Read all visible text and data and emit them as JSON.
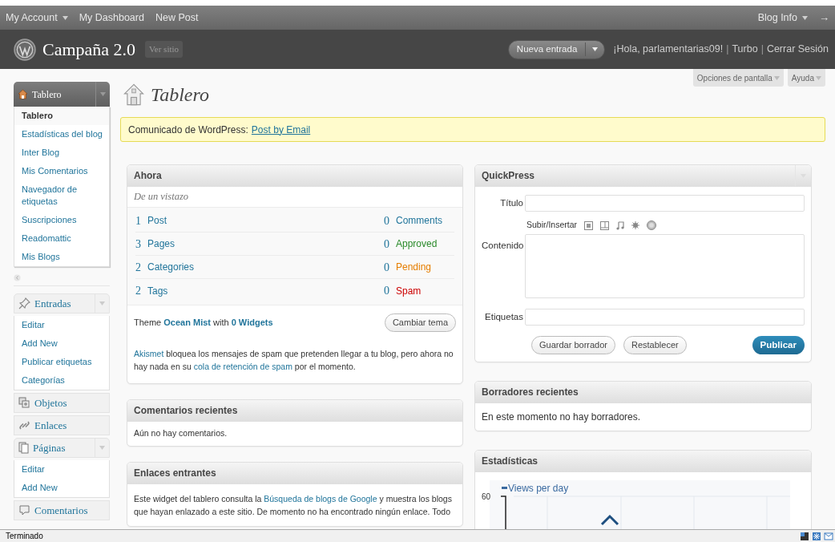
{
  "top_bar": {
    "left": [
      {
        "label": "My Account",
        "has_menu": true
      },
      {
        "label": "My Dashboard",
        "has_menu": false
      },
      {
        "label": "New Post",
        "has_menu": false
      }
    ],
    "right": {
      "label": "Blog Info",
      "has_menu": true
    },
    "exit": "→"
  },
  "header": {
    "site_title": "Campaña 2.0",
    "view_site": "Ver sitio",
    "new_post": "Nueva entrada",
    "greeting": "¡Hola, parlamentarias09!",
    "links": [
      {
        "separator": "|",
        "label": "Turbo"
      },
      {
        "separator": "|",
        "label": "Cerrar Sesión"
      }
    ]
  },
  "screen_tabs": [
    "Opciones de pantalla",
    "Ayuda"
  ],
  "page_title": "Tablero",
  "notice": {
    "text": "Comunicado de WordPress:",
    "link": "Post by Email"
  },
  "sidebar": {
    "menus": [
      {
        "label": "Tablero",
        "selected": true,
        "has_toggle": true,
        "children": [
          {
            "label": "Tablero",
            "selected": true
          },
          {
            "label": "Estadísticas del blog",
            "selected": false
          },
          {
            "label": "Inter Blog",
            "selected": false
          },
          {
            "label": "Mis Comentarios",
            "selected": false
          },
          {
            "label": "Navegador de etiquetas",
            "selected": false
          },
          {
            "label": "Suscripciones",
            "selected": false
          },
          {
            "label": "Readomattic",
            "selected": false
          },
          {
            "label": "Mis Blogs",
            "selected": false
          }
        ]
      },
      {
        "label": "Entradas",
        "selected": false,
        "has_toggle": true,
        "children": [
          {
            "label": "Editar",
            "selected": false
          },
          {
            "label": "Add New",
            "selected": false
          },
          {
            "label": "Publicar etiquetas",
            "selected": false
          },
          {
            "label": "Categorías",
            "selected": false
          }
        ]
      },
      {
        "label": "Objetos",
        "selected": false,
        "has_toggle": false
      },
      {
        "label": "Enlaces",
        "selected": false,
        "has_toggle": false
      },
      {
        "label": "Páginas",
        "selected": false,
        "has_toggle": true,
        "children": [
          {
            "label": "Editar",
            "selected": false
          },
          {
            "label": "Add New",
            "selected": false
          }
        ]
      },
      {
        "label": "Comentarios",
        "selected": false,
        "has_toggle": false
      }
    ]
  },
  "ahora": {
    "title": "Ahora",
    "subtitle": "De un vistazo",
    "rows": [
      {
        "count": "1",
        "label": "Post",
        "count2": "0",
        "label2": "Comments",
        "color": "#21759b"
      },
      {
        "count": "3",
        "label": "Pages",
        "count2": "0",
        "label2": "Approved",
        "color": "#2a8a2a"
      },
      {
        "count": "2",
        "label": "Categories",
        "count2": "0",
        "label2": "Pending",
        "color": "#e67e00"
      },
      {
        "count": "2",
        "label": "Tags",
        "count2": "0",
        "label2": "Spam",
        "color": "#cc0000"
      }
    ],
    "theme_line": [
      {
        "text": "Theme ",
        "link": false
      },
      {
        "text": "Ocean Mist",
        "link": true
      },
      {
        "text": " with ",
        "link": false
      },
      {
        "text": "0 Widgets",
        "link": true
      }
    ],
    "change_theme": "Cambiar tema",
    "akismet": [
      {
        "text": "Akismet",
        "link": true
      },
      {
        "text": " bloquea los mensajes de spam que pretenden llegar a tu blog, pero ahora no hay nada en su ",
        "link": false
      },
      {
        "text": "cola de retención de spam",
        "link": true
      },
      {
        "text": " por el momento.",
        "link": false
      }
    ]
  },
  "recent_comments": {
    "title": "Comentarios recientes",
    "text": "Aún no hay comentarios."
  },
  "incoming_links": {
    "title": "Enlaces entrantes",
    "text": [
      {
        "text": "Este widget del tablero consulta la ",
        "link": false
      },
      {
        "text": "Búsqueda de blogs de Google",
        "link": true
      },
      {
        "text": " y muestra los blogs que hayan enlazado a este sitio. De momento no ha encontrado ningún enlace. Todo",
        "link": false
      }
    ]
  },
  "quickpress": {
    "title": "QuickPress",
    "title_label": "Título",
    "upload_label": "Subir/Insertar",
    "content_label": "Contenido",
    "tags_label": "Etiquetas",
    "buttons": [
      "Guardar borrador",
      "Restablecer"
    ],
    "publish": "Publicar"
  },
  "drafts": {
    "title": "Borradores recientes",
    "text": "En este momento no hay borradores."
  },
  "stats": {
    "title": "Estadísticas",
    "legend": "Views per day",
    "tick": "60"
  },
  "status_bar": {
    "text": "Terminado"
  }
}
